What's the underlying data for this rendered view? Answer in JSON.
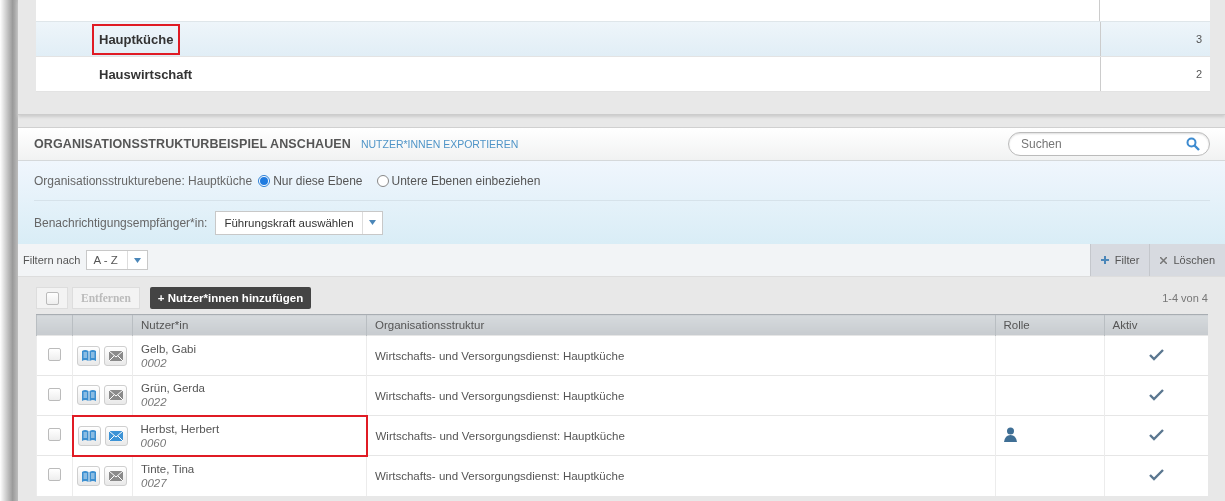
{
  "org_units": [
    {
      "name": "Hauptküche",
      "count": "3",
      "selected": true,
      "highlighted": true
    },
    {
      "name": "Hauswirtschaft",
      "count": "2",
      "selected": false,
      "highlighted": false
    }
  ],
  "panel": {
    "title": "ORGANISATIONSSTRUKTURBEISPIEL ANSCHAUEN",
    "export_link": "NUTZER*INNEN EXPORTIEREN",
    "search": {
      "placeholder": "Suchen"
    },
    "level_label": "Organisationsstrukturebene: Hauptküche",
    "scope_options": [
      {
        "label": "Nur diese Ebene",
        "selected": true
      },
      {
        "label": "Untere Ebenen einbeziehen",
        "selected": false
      }
    ],
    "recipient_label": "Benachrichtigungsempfänger*in:",
    "recipient_select": "Führungskraft auswählen",
    "filter_label": "Filtern nach",
    "filter_select": "A - Z",
    "filter_button": "Filter",
    "clear_button": "Löschen",
    "select_all_checked": false,
    "remove_button": "Entfernen",
    "add_button": "+ Nutzer*innen hinzufügen",
    "pagination": "1-4 von 4",
    "columns": [
      "Nutzer*in",
      "Organisationsstruktur",
      "Rolle",
      "Aktiv"
    ],
    "rows": [
      {
        "name": "Gelb, Gabi",
        "id": "0002",
        "org": "Wirtschafts- und Versorgungsdienst: Hauptküche",
        "checked": false,
        "mail_active": false,
        "has_role": false,
        "active": true,
        "highlighted": false
      },
      {
        "name": "Grün, Gerda",
        "id": "0022",
        "org": "Wirtschafts- und Versorgungsdienst: Hauptküche",
        "checked": false,
        "mail_active": false,
        "has_role": false,
        "active": true,
        "highlighted": false
      },
      {
        "name": "Herbst, Herbert",
        "id": "0060",
        "org": "Wirtschafts- und Versorgungsdienst: Hauptküche",
        "checked": false,
        "mail_active": true,
        "has_role": true,
        "active": true,
        "highlighted": true
      },
      {
        "name": "Tinte, Tina",
        "id": "0027",
        "org": "Wirtschafts- und Versorgungsdienst: Hauptküche",
        "checked": false,
        "mail_active": false,
        "has_role": false,
        "active": true,
        "highlighted": false
      }
    ]
  }
}
